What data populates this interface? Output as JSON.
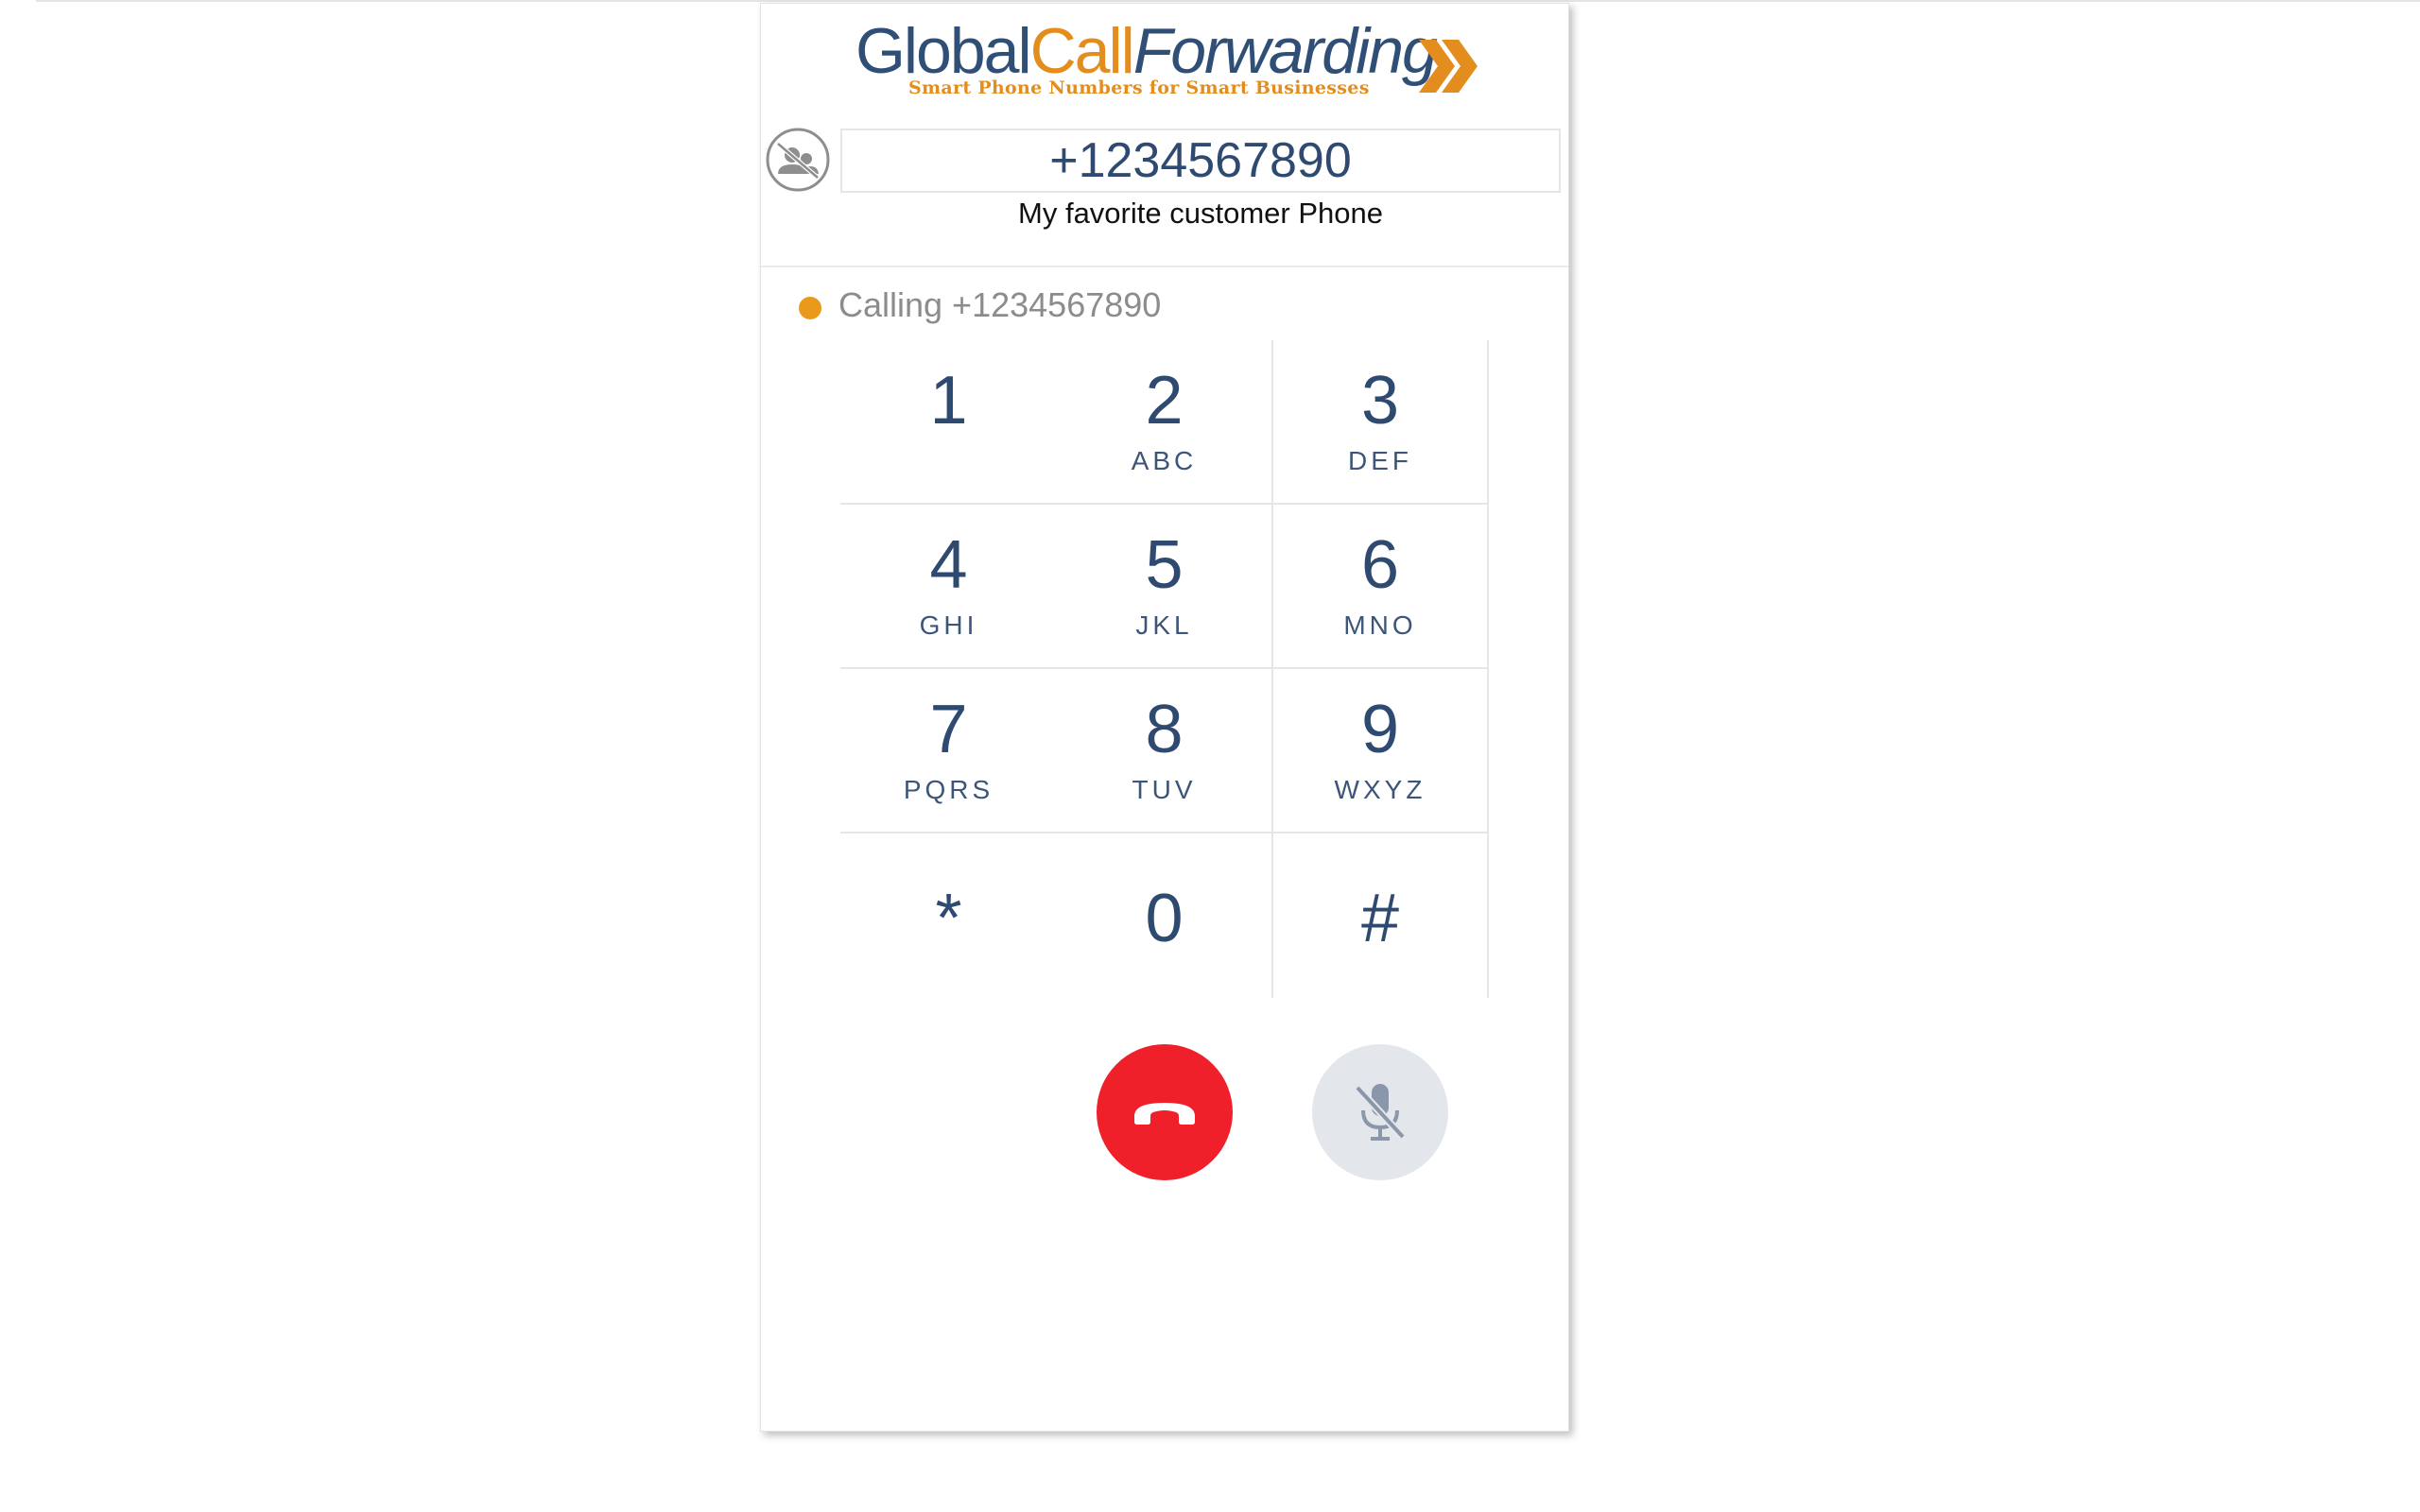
{
  "logo": {
    "part_global": "Global",
    "part_call": "Call",
    "part_forwarding": "Forwarding",
    "tagline": "Smart Phone Numbers for Smart Businesses",
    "colors": {
      "navy": "#2f4f77",
      "orange": "#e38d1f"
    }
  },
  "contact": {
    "icon": "no-contact-icon",
    "number": "+1234567890",
    "name": "My favorite customer Phone"
  },
  "status": {
    "text": "Calling +1234567890",
    "dot_color": "#ea9a1a"
  },
  "keypad": {
    "keys": [
      {
        "digit": "1",
        "letters": ""
      },
      {
        "digit": "2",
        "letters": "ABC"
      },
      {
        "digit": "3",
        "letters": "DEF"
      },
      {
        "digit": "4",
        "letters": "GHI"
      },
      {
        "digit": "5",
        "letters": "JKL"
      },
      {
        "digit": "6",
        "letters": "MNO"
      },
      {
        "digit": "7",
        "letters": "PQRS"
      },
      {
        "digit": "8",
        "letters": "TUV"
      },
      {
        "digit": "9",
        "letters": "WXYZ"
      },
      {
        "digit": "*",
        "letters": ""
      },
      {
        "digit": "0",
        "letters": ""
      },
      {
        "digit": "#",
        "letters": ""
      }
    ]
  },
  "controls": {
    "hangup": {
      "icon": "phone-hangup-icon",
      "color": "#f0202a"
    },
    "mute": {
      "icon": "microphone-muted-icon",
      "color": "#e3e7ec"
    }
  }
}
